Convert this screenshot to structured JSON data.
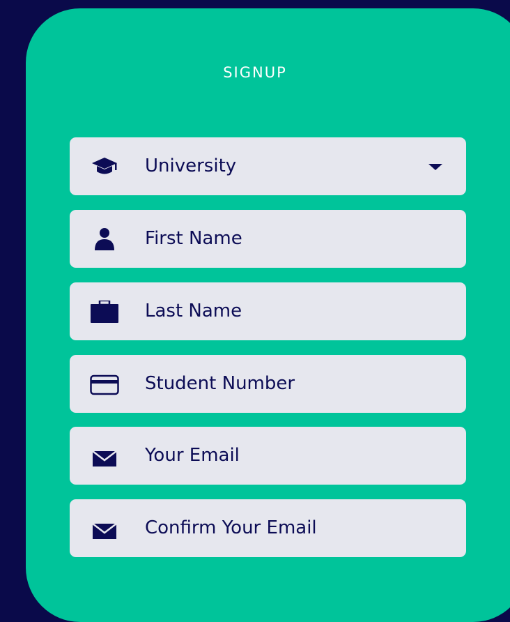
{
  "form": {
    "title": "SIGNUP",
    "fields": [
      {
        "label": "University",
        "icon": "graduation-cap-icon",
        "type": "select"
      },
      {
        "label": "First Name",
        "icon": "user-icon",
        "type": "text"
      },
      {
        "label": "Last Name",
        "icon": "briefcase-icon",
        "type": "text"
      },
      {
        "label": "Student Number",
        "icon": "credit-card-icon",
        "type": "text"
      },
      {
        "label": "Your Email",
        "icon": "envelope-icon",
        "type": "email"
      },
      {
        "label": "Confirm Your Email",
        "icon": "envelope-icon",
        "type": "email"
      }
    ]
  },
  "colors": {
    "background": "#0a0a4a",
    "card": "#00c49a",
    "field": "#e6e7ee",
    "text": "#0c0c55"
  }
}
